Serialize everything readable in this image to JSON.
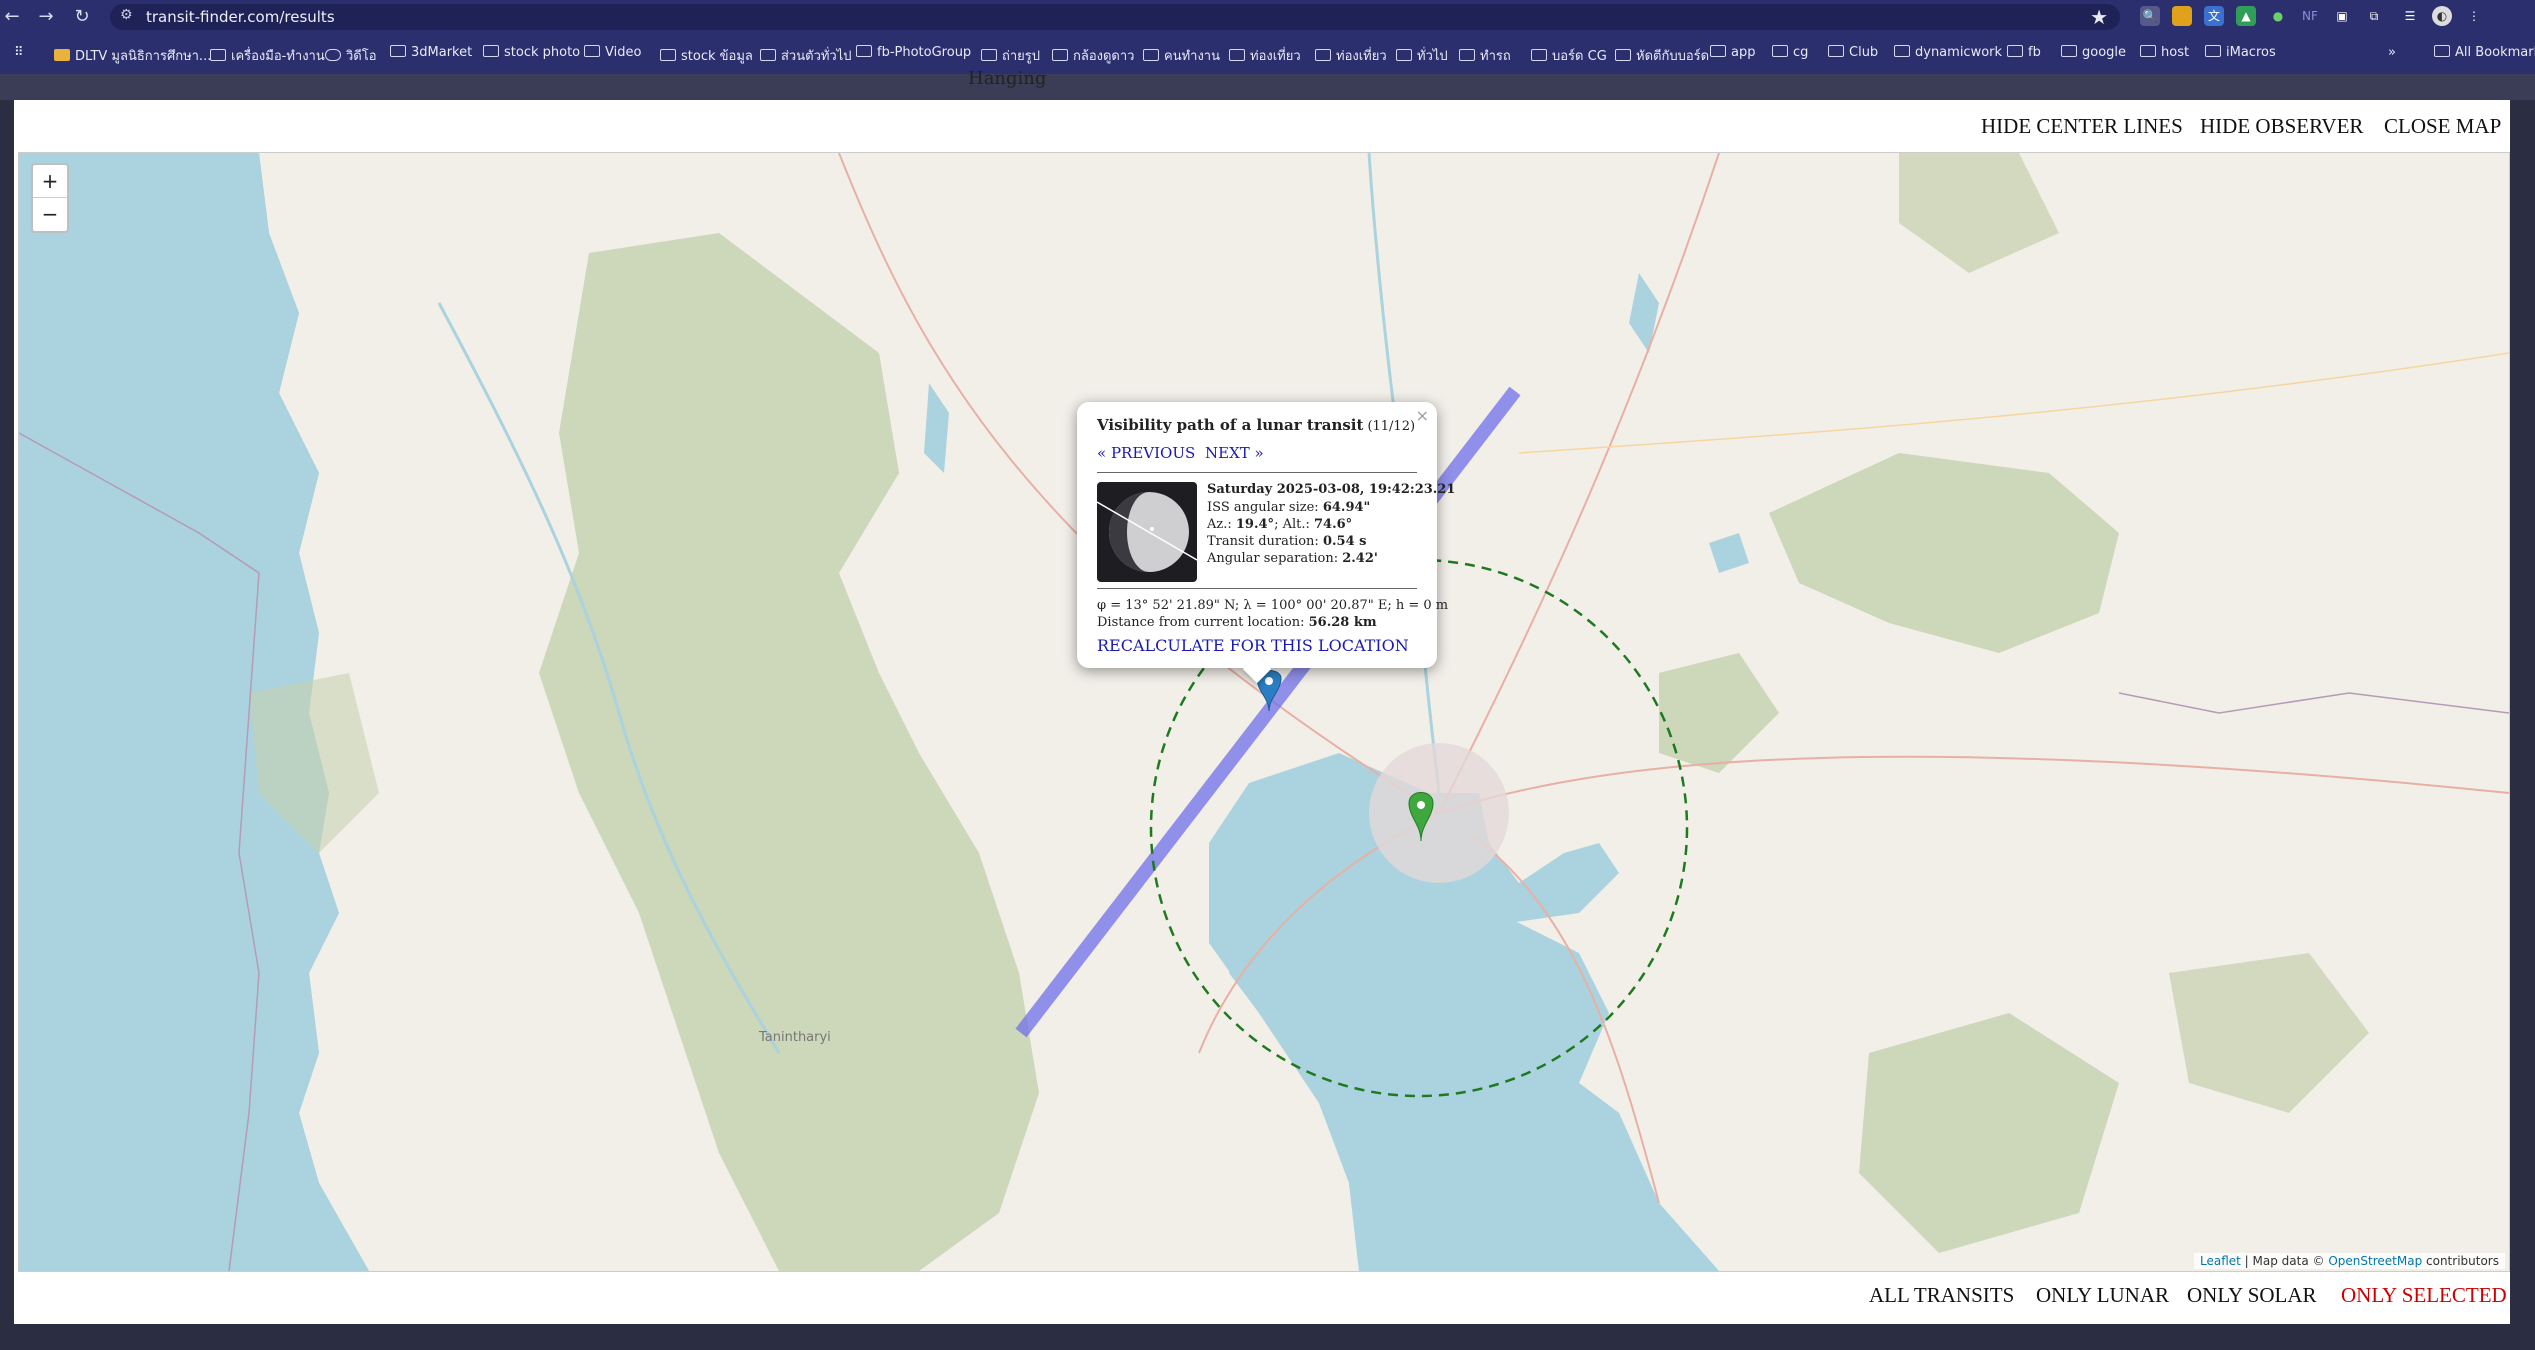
{
  "browser": {
    "url": "transit-finder.com/results",
    "bookmarks": [
      "DLTV มูลนิธิการศึกษา...",
      "เครื่องมือ-ทำงาน",
      "วิดีโอ",
      "3dMarket",
      "stock photo",
      "Video",
      "stock ข้อมูล",
      "ส่วนตัวทั่วไป",
      "fb-PhotoGroup",
      "ถ่ายรูป",
      "กล้องดูดาว",
      "คนทำงาน",
      "ท่องเที่ยว",
      "ท่องเที่ยว",
      "ทั่วไป",
      "ทำรถ",
      "บอร์ด CG",
      "หัดตีกับบอร์ด",
      "app",
      "cg",
      "Club",
      "dynamicwork",
      "fb",
      "google",
      "host",
      "iMacros"
    ],
    "all_bookmarks": "All Bookmarks"
  },
  "page": {
    "strip_text": "Hanging"
  },
  "map_controls": {
    "hide_center_lines": "HIDE CENTER LINES",
    "hide_observer": "HIDE OBSERVER",
    "close_map": "CLOSE MAP",
    "zoom_in": "+",
    "zoom_out": "−"
  },
  "filters": {
    "all_transits": "ALL TRANSITS",
    "only_lunar": "ONLY LUNAR",
    "only_solar": "ONLY SOLAR",
    "only_selected": "ONLY SELECTED"
  },
  "attribution": {
    "leaflet": "Leaflet",
    "prefix": "| Map data ©",
    "osm": "OpenStreetMap",
    "suffix": "contributors"
  },
  "map_labels": {
    "region": "Tanintharyi"
  },
  "popup": {
    "title": "Visibility path of a lunar transit",
    "count": "(11/12)",
    "close": "×",
    "previous": "« PREVIOUS",
    "next": "NEXT »",
    "datetime": "Saturday 2025-03-08, 19:42:23.21",
    "angular_size_label": "ISS angular size:",
    "angular_size_value": "64.94\"",
    "az_label": "Az.:",
    "az_value": "19.4°",
    "alt_label": "Alt.:",
    "alt_value": "74.6°",
    "duration_label": "Transit duration:",
    "duration_value": "0.54 s",
    "separation_label": "Angular separation:",
    "separation_value": "2.42'",
    "coordinates": "φ = 13° 52' 21.89\" N; λ = 100° 00' 20.87\" E; h = 0 m",
    "distance_label": "Distance from current location:",
    "distance_value": "56.28 km",
    "recalculate": "RECALCULATE FOR THIS LOCATION"
  },
  "colors": {
    "chrome": "#2c2f6e",
    "transit_path": "#6f6fe8",
    "observer_circle": "#1f7a1f",
    "observer_marker": "#3ea83e",
    "transit_marker": "#2a7fc2",
    "selected_filter": "#cc0000",
    "link": "#1a1ab0"
  }
}
